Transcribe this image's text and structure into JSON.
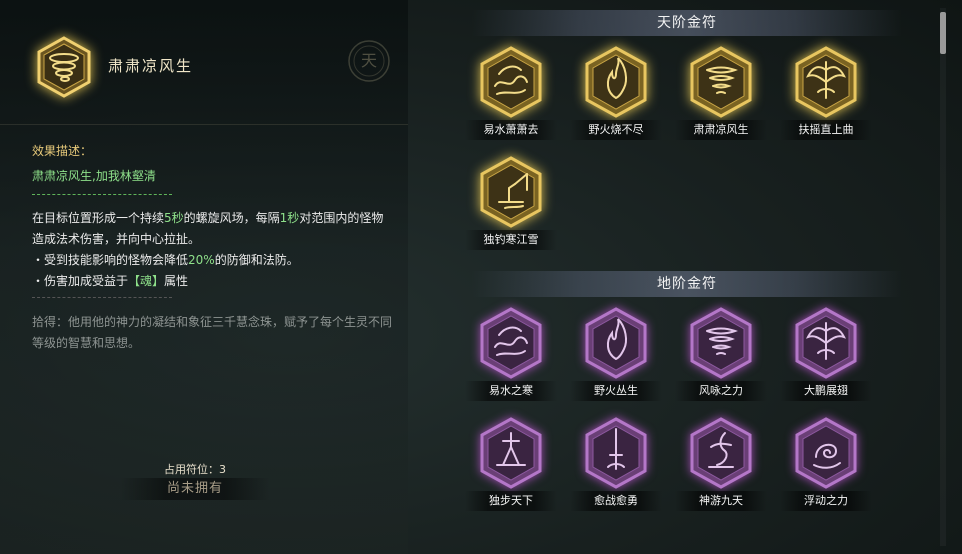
{
  "detail": {
    "icon": "tornado-talisman-icon",
    "name": "肃肃凉风生",
    "tier_seal_char": "天",
    "effect_label": "效果描述：",
    "subtitle": "肃肃凉风生,加我林壑清",
    "desc_line1": {
      "a": "在目标位置形成一个持续",
      "b": "5秒",
      "c": "的螺旋风场，每隔",
      "d": "1秒",
      "e": "对范围内的怪物造成法术伤害，并向中心拉扯。"
    },
    "desc_line2": {
      "a": "・受到技能影响的怪物会降低",
      "b": "20%",
      "c": "的防御和法防。"
    },
    "desc_line3": {
      "a": "・伤害加成受益于",
      "b": "【魂】",
      "c": "属性"
    },
    "lore": "拾得：他用他的神力的凝结和象征三千慧念珠，赋予了每个生灵不同等级的智慧和思想。",
    "slots": "占用符位：3",
    "owned_status": "尚未拥有"
  },
  "sections": [
    {
      "title": "天阶金符",
      "tier": "gold",
      "items": [
        {
          "name": "易水萧萧去",
          "icon": "wave-dragon-icon"
        },
        {
          "name": "野火烧不尽",
          "icon": "flame-icon"
        },
        {
          "name": "肃肃凉风生",
          "icon": "tornado-icon"
        },
        {
          "name": "扶摇直上曲",
          "icon": "wings-icon"
        },
        {
          "name": "独钓寒江雪",
          "icon": "fisherman-icon"
        }
      ]
    },
    {
      "title": "地阶金符",
      "tier": "purple",
      "items": [
        {
          "name": "易水之寒",
          "icon": "wave-dragon-icon"
        },
        {
          "name": "野火丛生",
          "icon": "flame-icon"
        },
        {
          "name": "风咏之力",
          "icon": "tornado-icon"
        },
        {
          "name": "大鹏展翅",
          "icon": "wings-icon"
        },
        {
          "name": "独步天下",
          "icon": "warrior-icon"
        },
        {
          "name": "愈战愈勇",
          "icon": "sword-icon"
        },
        {
          "name": "神游九天",
          "icon": "dancer-icon"
        },
        {
          "name": "浮动之力",
          "icon": "swirl-icon"
        }
      ]
    }
  ],
  "colors": {
    "gold_frame": "#e8c660",
    "purple_frame": "#b477c8",
    "highlight_green": "#8ee08a",
    "label_gold": "#e7c97a"
  }
}
